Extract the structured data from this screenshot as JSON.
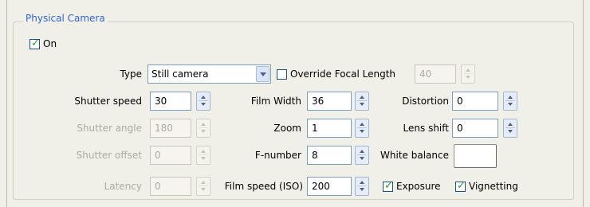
{
  "group": {
    "title": "Physical Camera",
    "on_label": "On",
    "on_checked": true
  },
  "type": {
    "label": "Type",
    "value": "Still camera"
  },
  "override_focal": {
    "label": "Override Focal Length",
    "checked": false,
    "value": "40"
  },
  "shutter_speed": {
    "label": "Shutter speed",
    "value": "30"
  },
  "shutter_angle": {
    "label": "Shutter angle",
    "value": "180"
  },
  "shutter_offset": {
    "label": "Shutter offset",
    "value": "0"
  },
  "latency": {
    "label": "Latency",
    "value": "0"
  },
  "film_width": {
    "label": "Film Width",
    "value": "36"
  },
  "zoom": {
    "label": "Zoom",
    "value": "1"
  },
  "f_number": {
    "label": "F-number",
    "value": "8"
  },
  "film_speed": {
    "label": "Film speed (ISO)",
    "value": "200"
  },
  "distortion": {
    "label": "Distortion",
    "value": "0"
  },
  "lens_shift": {
    "label": "Lens shift",
    "value": "0"
  },
  "white_balance": {
    "label": "White balance",
    "color": "#ffffff"
  },
  "exposure": {
    "label": "Exposure",
    "checked": true
  },
  "vignetting": {
    "label": "Vignetting",
    "checked": true
  }
}
